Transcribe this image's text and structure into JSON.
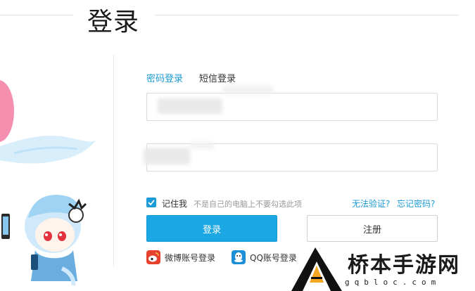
{
  "header": {
    "title": "登录"
  },
  "tabs": [
    {
      "label": "密码登录",
      "active": true
    },
    {
      "label": "短信登录",
      "active": false
    }
  ],
  "form": {
    "account_value": "",
    "password_value": ""
  },
  "remember": {
    "checked": true,
    "label": "记住我",
    "hint": "不是自己的电脑上不要勾选此项"
  },
  "links": {
    "cant_verify": "无法验证?",
    "forgot_password": "忘记密码?"
  },
  "buttons": {
    "login": "登录",
    "register": "注册"
  },
  "social": {
    "weibo": "微博账号登录",
    "qq": "QQ账号登录"
  },
  "watermark": {
    "name": "桥本手游网",
    "domain": "gqbloc.com"
  },
  "colors": {
    "accent": "#1b9bd7",
    "login_button": "#1aa7e3"
  }
}
